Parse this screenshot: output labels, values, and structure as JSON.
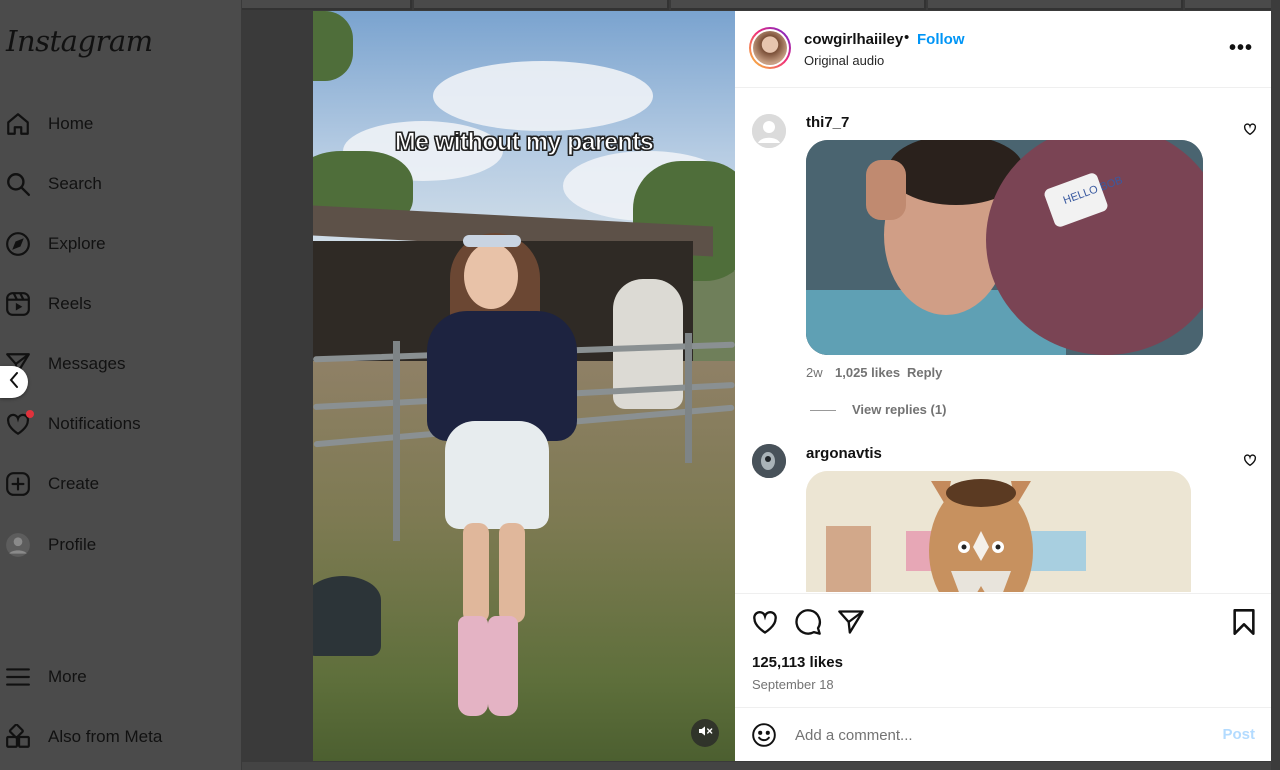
{
  "sidebar": {
    "logo": "Instagram",
    "items": [
      {
        "label": "Home",
        "icon": "home-icon"
      },
      {
        "label": "Search",
        "icon": "search-icon"
      },
      {
        "label": "Explore",
        "icon": "compass-icon"
      },
      {
        "label": "Reels",
        "icon": "reels-icon"
      },
      {
        "label": "Messages",
        "icon": "send-icon"
      },
      {
        "label": "Notifications",
        "icon": "heart-icon"
      },
      {
        "label": "Create",
        "icon": "plus-square-icon"
      },
      {
        "label": "Profile",
        "icon": "avatar-icon"
      },
      {
        "label": "More",
        "icon": "menu-icon"
      },
      {
        "label": "Also from Meta",
        "icon": "meta-apps-icon"
      }
    ]
  },
  "post": {
    "media_caption": "Me without my parents",
    "author": {
      "username": "cowgirlhaiiley",
      "follow_label": "Follow",
      "audio": "Original audio"
    },
    "likes": "125,113 likes",
    "date": "September 18",
    "add_comment_placeholder": "Add a comment...",
    "post_label": "Post"
  },
  "comments": [
    {
      "username": "thi7_7",
      "age": "2w",
      "likes": "1,025 likes",
      "reply_label": "Reply",
      "view_replies": "View replies (1)",
      "gif_badge_text": "HELLO BOB"
    },
    {
      "username": "argonavtis"
    }
  ],
  "colors": {
    "accent": "#0095f6",
    "post_disabled": "#b3dbff",
    "notification_dot": "#e0323c"
  }
}
